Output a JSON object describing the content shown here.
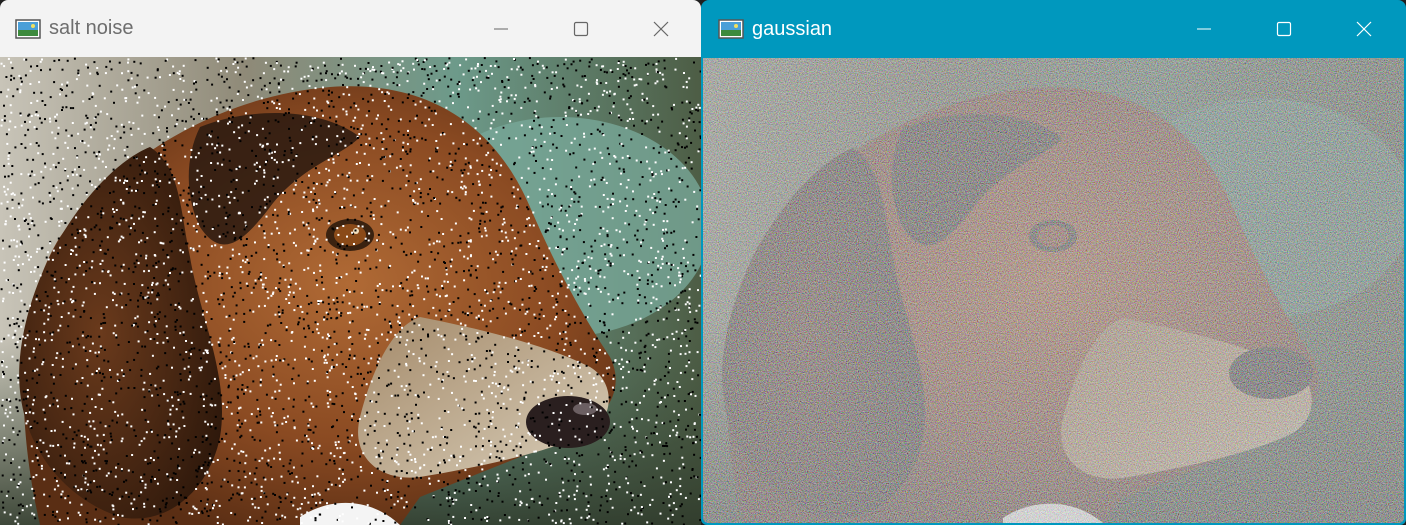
{
  "windows": [
    {
      "title": "salt noise",
      "state": "inactive",
      "titlebar_color": "#f3f3f3",
      "controls": [
        "minimize-icon",
        "maximize-icon",
        "close-icon"
      ],
      "image": "beagle photo with salt-and-pepper noise"
    },
    {
      "title": "gaussian",
      "state": "active",
      "titlebar_color": "#0098be",
      "controls": [
        "minimize-icon",
        "maximize-icon",
        "close-icon"
      ],
      "image": "beagle photo with gaussian noise"
    }
  ]
}
